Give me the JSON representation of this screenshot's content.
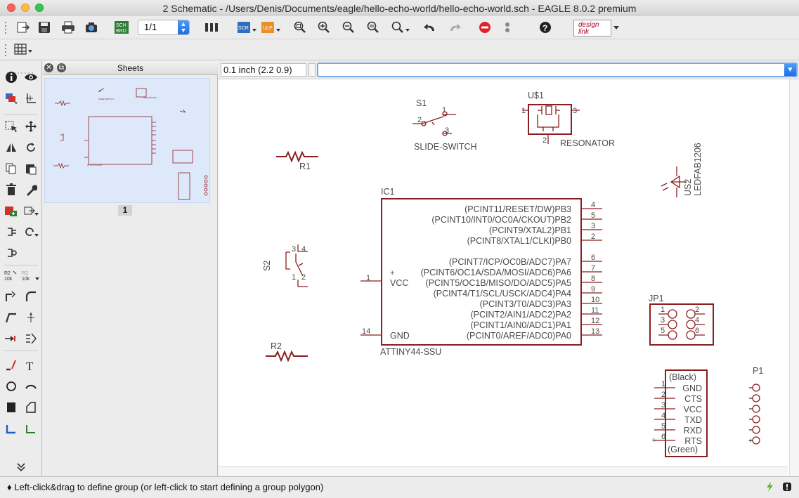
{
  "window": {
    "title": "2 Schematic - /Users/Denis/Documents/eagle/hello-echo-world/hello-echo-world.sch - EAGLE 8.0.2 premium"
  },
  "toolbar": {
    "sheet_value": "1/1",
    "scr_label": "SCR",
    "ulp_label": "ULP",
    "sch_brd_label": "SCH\nBRD",
    "designlink_label": "design link"
  },
  "sheets_panel": {
    "title": "Sheets",
    "sheet_number": "1"
  },
  "command_bar": {
    "coordinates": "0.1 inch (2.2 0.9)",
    "command_value": ""
  },
  "status": {
    "message": "♦ Left-click&drag to define group (or left-click to start defining a group polygon)"
  },
  "schematic": {
    "s1": {
      "name": "S1",
      "value": "SLIDE-SWITCH",
      "pins": [
        "1",
        "2",
        "3"
      ]
    },
    "u1": {
      "name": "U$1",
      "value": "RESONATOR",
      "pins": [
        "1",
        "2",
        "3"
      ]
    },
    "r1": {
      "name": "R1"
    },
    "r2": {
      "name": "R2"
    },
    "s2": {
      "name": "S2",
      "pins": [
        "1",
        "2",
        "3",
        "4"
      ]
    },
    "us2": {
      "name": "US2",
      "value": "LEDFAB1206"
    },
    "ic1": {
      "name": "IC1",
      "value": "ATTINY44-SSU",
      "vcc_label": "VCC",
      "gnd_label": "GND",
      "vcc_pin": "1",
      "gnd_pin": "14",
      "plus": "+",
      "pins": [
        {
          "label": "(PCINT11/RESET/DW)PB3",
          "num": "4"
        },
        {
          "label": "(PCINT10/INT0/OC0A/CKOUT)PB2",
          "num": "5"
        },
        {
          "label": "(PCINT9/XTAL2)PB1",
          "num": "3"
        },
        {
          "label": "(PCINT8/XTAL1/CLKI)PB0",
          "num": "2"
        },
        {
          "label": "(PCINT7/ICP/OC0B/ADC7)PA7",
          "num": "6"
        },
        {
          "label": "(PCINT6/OC1A/SDA/MOSI/ADC6)PA6",
          "num": "7"
        },
        {
          "label": "(PCINT5/OC1B/MISO/DO/ADC5)PA5",
          "num": "8"
        },
        {
          "label": "(PCINT4/T1/SCL/USCK/ADC4)PA4",
          "num": "9"
        },
        {
          "label": "(PCINT3/T0/ADC3)PA3",
          "num": "10"
        },
        {
          "label": "(PCINT2/AIN1/ADC2)PA2",
          "num": "11"
        },
        {
          "label": "(PCINT1/AIN0/ADC1)PA1",
          "num": "12"
        },
        {
          "label": "(PCINT0/AREF/ADC0)PA0",
          "num": "13"
        }
      ]
    },
    "jp1": {
      "name": "JP1",
      "pins": [
        "1",
        "2",
        "3",
        "4",
        "5",
        "6"
      ]
    },
    "ftdi": {
      "top": "(Black)",
      "bottom": "(Green)",
      "plus": "+",
      "pins": [
        {
          "num": "1",
          "label": "GND"
        },
        {
          "num": "2",
          "label": "CTS"
        },
        {
          "num": "3",
          "label": "VCC"
        },
        {
          "num": "4",
          "label": "TXD"
        },
        {
          "num": "5",
          "label": "RXD"
        },
        {
          "num": "6",
          "label": "RTS"
        }
      ]
    },
    "p1": {
      "name": "P1",
      "plus": "+"
    }
  },
  "colors": {
    "symbol": "#8b1e1e",
    "label": "#4a4a4a",
    "sheet_bg": "#dde9fb",
    "accent": "#1b6ee8"
  }
}
